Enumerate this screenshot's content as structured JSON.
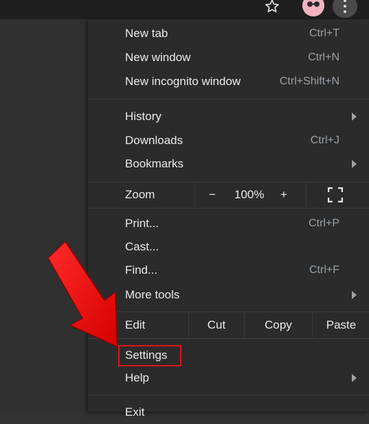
{
  "menu": {
    "group1": [
      {
        "label": "New tab",
        "shortcut": "Ctrl+T"
      },
      {
        "label": "New window",
        "shortcut": "Ctrl+N"
      },
      {
        "label": "New incognito window",
        "shortcut": "Ctrl+Shift+N"
      }
    ],
    "group2": [
      {
        "label": "History",
        "shortcut": ""
      },
      {
        "label": "Downloads",
        "shortcut": "Ctrl+J"
      },
      {
        "label": "Bookmarks",
        "shortcut": ""
      }
    ],
    "zoom": {
      "label": "Zoom",
      "minus": "−",
      "value": "100%",
      "plus": "+"
    },
    "group3": [
      {
        "label": "Print...",
        "shortcut": "Ctrl+P"
      },
      {
        "label": "Cast...",
        "shortcut": ""
      },
      {
        "label": "Find...",
        "shortcut": "Ctrl+F"
      },
      {
        "label": "More tools",
        "shortcut": ""
      }
    ],
    "edit": {
      "label": "Edit",
      "cut": "Cut",
      "copy": "Copy",
      "paste": "Paste"
    },
    "group4": [
      {
        "label": "Settings"
      },
      {
        "label": "Help"
      }
    ],
    "exit": {
      "label": "Exit"
    }
  },
  "colors": {
    "highlight": "#e0141c",
    "menu_bg": "#2b2b2b"
  }
}
